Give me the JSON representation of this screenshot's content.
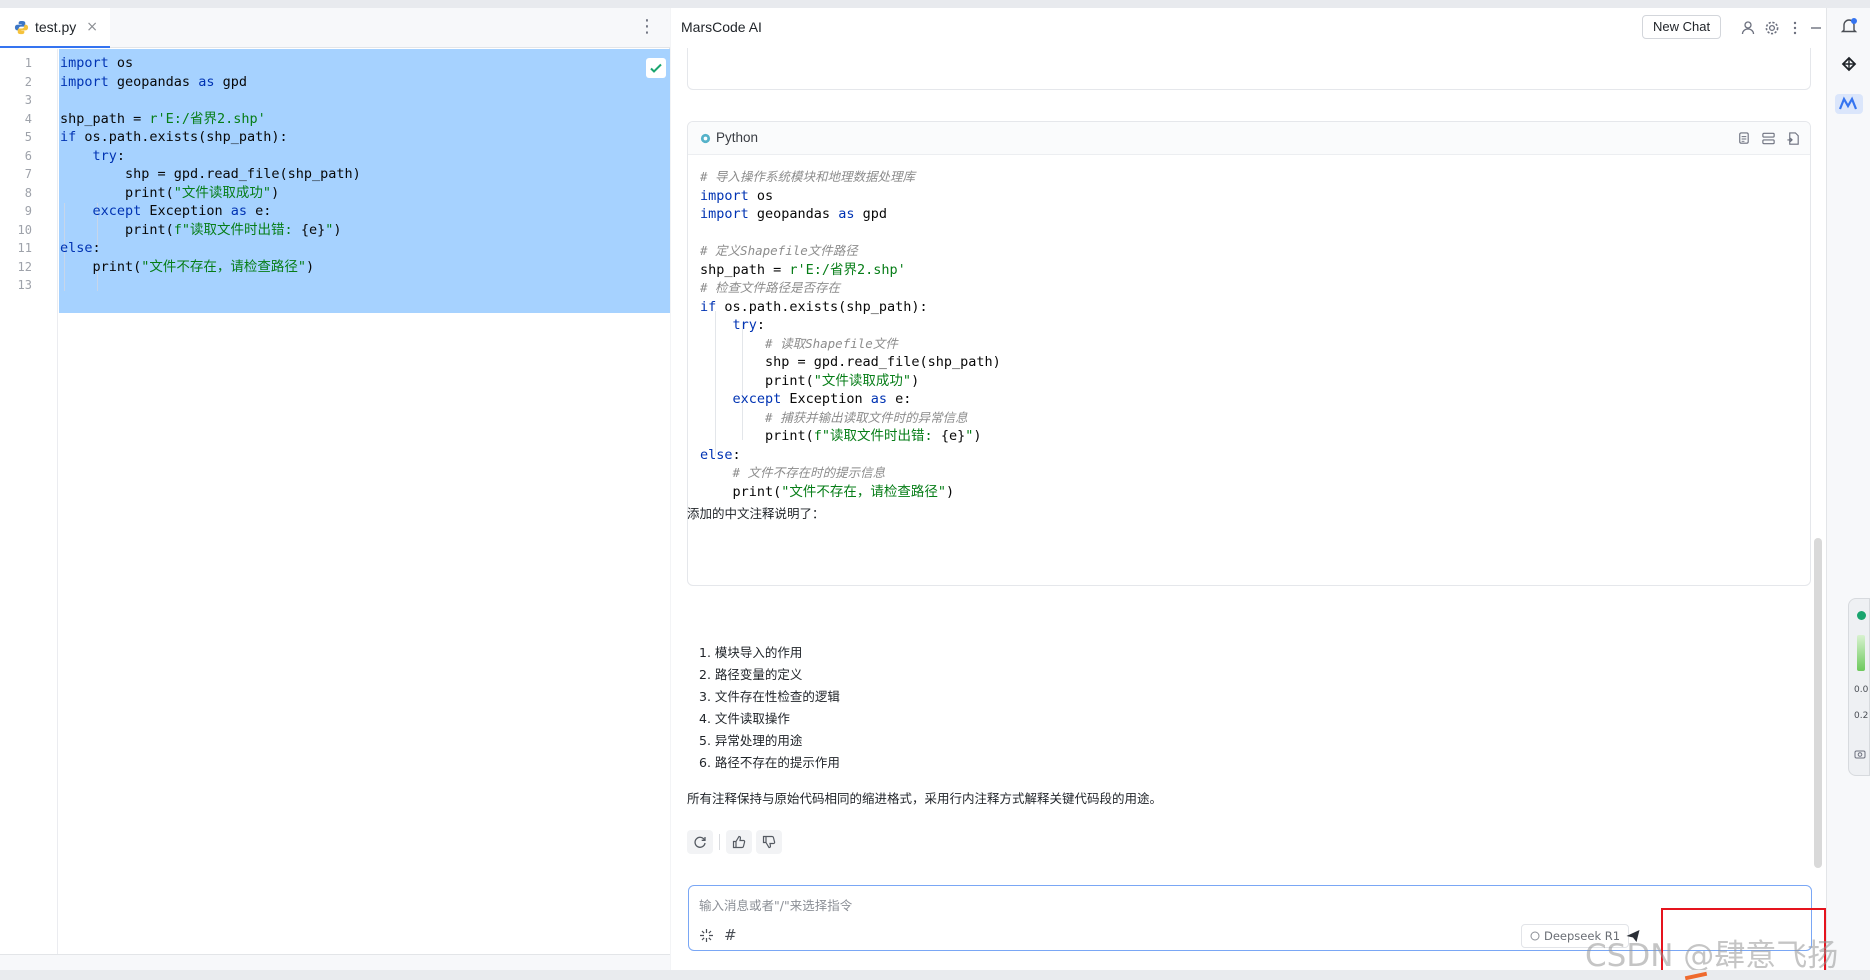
{
  "editor": {
    "tab": {
      "filename": "test.py",
      "close_glyph": "×"
    },
    "menu_glyph": "⋮",
    "lines": [
      {
        "n": "1",
        "code": [
          {
            "t": "import",
            "c": "kw"
          },
          {
            "t": " os",
            "c": ""
          }
        ]
      },
      {
        "n": "2",
        "code": [
          {
            "t": "import",
            "c": "kw"
          },
          {
            "t": " geopandas ",
            "c": ""
          },
          {
            "t": "as",
            "c": "kw"
          },
          {
            "t": " gpd",
            "c": ""
          }
        ]
      },
      {
        "n": "3",
        "code": []
      },
      {
        "n": "4",
        "code": [
          {
            "t": "shp_path = ",
            "c": ""
          },
          {
            "t": "r'E:/省界2.shp'",
            "c": "str"
          }
        ]
      },
      {
        "n": "5",
        "code": [
          {
            "t": "if",
            "c": "kw"
          },
          {
            "t": " os.path.exists(shp_path):",
            "c": ""
          }
        ]
      },
      {
        "n": "6",
        "code": [
          {
            "t": "    ",
            "c": ""
          },
          {
            "t": "try",
            "c": "kw"
          },
          {
            "t": ":",
            "c": ""
          }
        ]
      },
      {
        "n": "7",
        "code": [
          {
            "t": "        shp = gpd.read_file(shp_path)",
            "c": ""
          }
        ]
      },
      {
        "n": "8",
        "code": [
          {
            "t": "        print(",
            "c": ""
          },
          {
            "t": "\"文件读取成功\"",
            "c": "str"
          },
          {
            "t": ")",
            "c": ""
          }
        ]
      },
      {
        "n": "9",
        "code": [
          {
            "t": "    ",
            "c": ""
          },
          {
            "t": "except",
            "c": "kw"
          },
          {
            "t": " Exception ",
            "c": ""
          },
          {
            "t": "as",
            "c": "kw"
          },
          {
            "t": " e:",
            "c": ""
          }
        ]
      },
      {
        "n": "10",
        "code": [
          {
            "t": "        print(",
            "c": ""
          },
          {
            "t": "f\"读取文件时出错: ",
            "c": "str"
          },
          {
            "t": "{e}",
            "c": ""
          },
          {
            "t": "\"",
            "c": "str"
          },
          {
            "t": ")",
            "c": ""
          }
        ]
      },
      {
        "n": "11",
        "code": [
          {
            "t": "else",
            "c": "kw"
          },
          {
            "t": ":",
            "c": ""
          }
        ]
      },
      {
        "n": "12",
        "code": [
          {
            "t": "    print(",
            "c": ""
          },
          {
            "t": "\"文件不存在，请检查路径\"",
            "c": "str"
          },
          {
            "t": ")",
            "c": ""
          }
        ]
      },
      {
        "n": "13",
        "code": []
      }
    ]
  },
  "chat": {
    "title": "MarsCode AI",
    "new_chat_label": "New Chat",
    "code_card": {
      "language": "Python",
      "lines": [
        [
          {
            "t": "# 导入操作系统模块和地理数据处理库",
            "c": "cmt"
          }
        ],
        [
          {
            "t": "import",
            "c": "kw"
          },
          {
            "t": " os",
            "c": ""
          }
        ],
        [
          {
            "t": "import",
            "c": "kw"
          },
          {
            "t": " geopandas ",
            "c": ""
          },
          {
            "t": "as",
            "c": "kw"
          },
          {
            "t": " gpd",
            "c": ""
          }
        ],
        [],
        [
          {
            "t": "# 定义Shapefile文件路径",
            "c": "cmt"
          }
        ],
        [
          {
            "t": "shp_path = ",
            "c": ""
          },
          {
            "t": "r'E:/省界2.shp'",
            "c": "str"
          }
        ],
        [
          {
            "t": "# 检查文件路径是否存在",
            "c": "cmt"
          }
        ],
        [
          {
            "t": "if",
            "c": "kw"
          },
          {
            "t": " os.path.exists(shp_path):",
            "c": ""
          }
        ],
        [
          {
            "t": "    ",
            "c": ""
          },
          {
            "t": "try",
            "c": "kw"
          },
          {
            "t": ":",
            "c": ""
          }
        ],
        [
          {
            "t": "        ",
            "c": ""
          },
          {
            "t": "# 读取Shapefile文件",
            "c": "cmt"
          }
        ],
        [
          {
            "t": "        shp = gpd.read_file(shp_path)",
            "c": ""
          }
        ],
        [
          {
            "t": "        print(",
            "c": ""
          },
          {
            "t": "\"文件读取成功\"",
            "c": "str"
          },
          {
            "t": ")",
            "c": ""
          }
        ],
        [
          {
            "t": "    ",
            "c": ""
          },
          {
            "t": "except",
            "c": "kw"
          },
          {
            "t": " Exception ",
            "c": ""
          },
          {
            "t": "as",
            "c": "kw"
          },
          {
            "t": " e:",
            "c": ""
          }
        ],
        [
          {
            "t": "        ",
            "c": ""
          },
          {
            "t": "# 捕获并输出读取文件时的异常信息",
            "c": "cmt"
          }
        ],
        [
          {
            "t": "        print(",
            "c": ""
          },
          {
            "t": "f\"读取文件时出错: ",
            "c": "str"
          },
          {
            "t": "{e}",
            "c": ""
          },
          {
            "t": "\"",
            "c": "str"
          },
          {
            "t": ")",
            "c": ""
          }
        ],
        [
          {
            "t": "else",
            "c": "kw"
          },
          {
            "t": ":",
            "c": ""
          }
        ],
        [
          {
            "t": "    ",
            "c": ""
          },
          {
            "t": "# 文件不存在时的提示信息",
            "c": "cmt"
          }
        ],
        [
          {
            "t": "    print(",
            "c": ""
          },
          {
            "t": "\"文件不存在，请检查路径\"",
            "c": "str"
          },
          {
            "t": ")",
            "c": ""
          }
        ]
      ]
    },
    "answer_intro": "添加的中文注释说明了：",
    "answer_items": [
      "1. 模块导入的作用",
      "2. 路径变量的定义",
      "3. 文件存在性检查的逻辑",
      "4. 文件读取操作",
      "5. 异常处理的用途",
      "6. 路径不存在的提示作用"
    ],
    "answer_summary": "所有注释保持与原始代码相同的缩进格式，采用行内注释方式解释关键代码段的用途。",
    "input_placeholder": "输入消息或者\"/\"来选择指令",
    "input_tool_hash": "#",
    "model_label": "Deepseek R1"
  },
  "widget": {
    "val1": "0.0",
    "val2": "0.2"
  },
  "watermark": "CSDN @肆意飞扬",
  "colors": {
    "accent": "#3574f0",
    "selection": "#a6d2ff",
    "keyword": "#0033b3",
    "string": "#067d17",
    "highlight_box": "#e5141e"
  }
}
